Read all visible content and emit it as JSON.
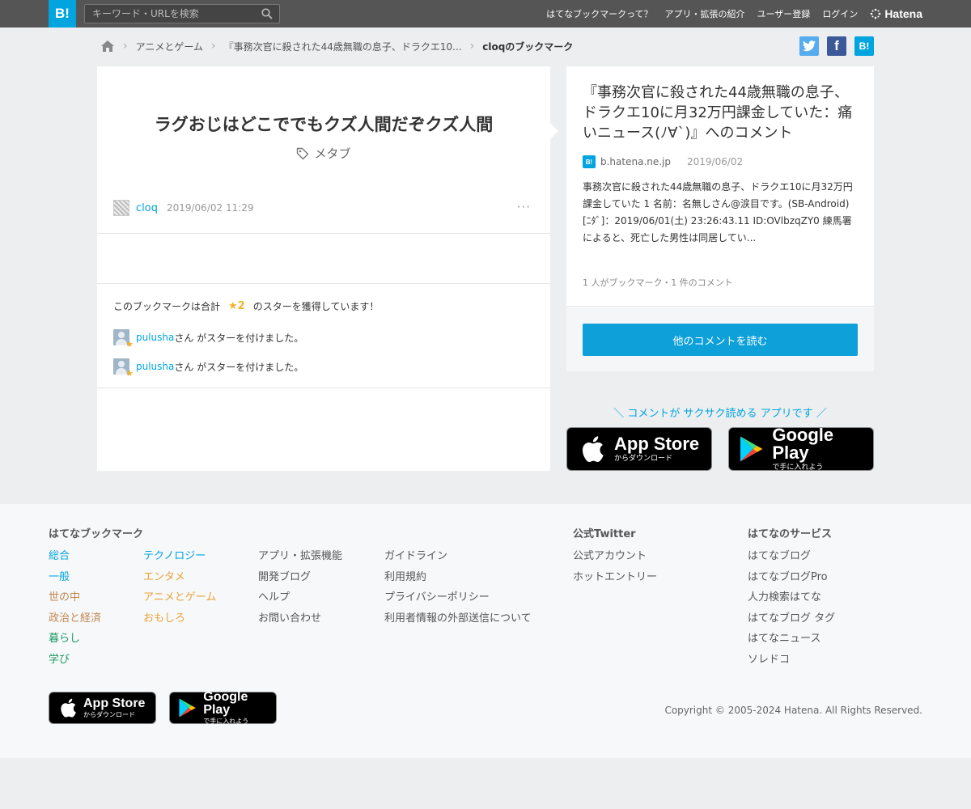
{
  "header": {
    "logo": "B!",
    "search_placeholder": "キーワード・URLを検索",
    "nav": [
      "はてなブックマークって？",
      "アプリ・拡張の紹介",
      "ユーザー登録",
      "ログイン"
    ],
    "brand": "Hatena"
  },
  "breadcrumb": {
    "items": [
      "アニメとゲーム",
      "『事務次官に殺された44歳無職の息子、ドラクエ10...",
      "cloqのブックマーク"
    ]
  },
  "share": {
    "twitter": "t",
    "facebook": "f",
    "hatena": "B!"
  },
  "bookmark": {
    "comment": "ラグおじはどこででもクズ人間だぞクズ人間",
    "tag": "メタブ",
    "user": "cloq",
    "datetime": "2019/06/02 11:29",
    "more": "···"
  },
  "stars": {
    "summary_prefix": "このブックマークは合計",
    "count": "★2",
    "summary_suffix": "のスターを獲得しています！",
    "entries": [
      {
        "user": "pulusha",
        "text": "さん がスターを付けました。"
      },
      {
        "user": "pulusha",
        "text": "さん がスターを付けました。"
      }
    ]
  },
  "entry": {
    "title": "『事務次官に殺された44歳無職の息子、ドラクエ10に月32万円課金していた：痛いニュース(ﾉ∀`)』へのコメント",
    "favicon": "B!",
    "source": "b.hatena.ne.jp",
    "date": "2019/06/02",
    "excerpt": "事務次官に殺された44歳無職の息子、ドラクエ10に月32万円課金していた 1 名前：名無しさん@涙目です。(SB-Android) [ﾆﾀﾞ]：2019/06/01(土) 23:26:43.11 ID:OVlbzqZY0 練馬署によると、死亡した男性は同居してい...",
    "counts": "1 人がブックマーク・1 件のコメント",
    "read_button": "他のコメントを読む"
  },
  "promo": {
    "text": "＼ コメントが サクサク読める アプリです ／",
    "appstore_big": "App Store",
    "appstore_small": "からダウンロード",
    "googleplay_big": "Google Play",
    "googleplay_small": "で手に入れよう"
  },
  "footer": {
    "heading1": "はてなブックマーク",
    "col1": [
      {
        "label": "総合",
        "color": "#00a4de"
      },
      {
        "label": "一般",
        "color": "#00a4de"
      },
      {
        "label": "世の中",
        "color": "#c0864f"
      },
      {
        "label": "政治と経済",
        "color": "#c0864f"
      },
      {
        "label": "暮らし",
        "color": "#1b9a65"
      },
      {
        "label": "学び",
        "color": "#1b9a65"
      }
    ],
    "col2": [
      {
        "label": "テクノロジー",
        "color": "#00a4de"
      },
      {
        "label": "エンタメ",
        "color": "#e8a33a"
      },
      {
        "label": "アニメとゲーム",
        "color": "#e8a33a"
      },
      {
        "label": "おもしろ",
        "color": "#e8a33a"
      }
    ],
    "col3": [
      "アプリ・拡張機能",
      "開発ブログ",
      "ヘルプ",
      "お問い合わせ"
    ],
    "col4": [
      "ガイドライン",
      "利用規約",
      "プライバシーポリシー",
      "利用者情報の外部送信について"
    ],
    "heading2": "公式Twitter",
    "col5": [
      "公式アカウント",
      "ホットエントリー"
    ],
    "heading3": "はてなのサービス",
    "col6": [
      "はてなブログ",
      "はてなブログPro",
      "人力検索はてな",
      "はてなブログ タグ",
      "はてなニュース",
      "ソレドコ"
    ],
    "copyright": "Copyright © 2005-2024 Hatena. All Rights Reserved."
  },
  "colors": {
    "accent": "#00a4de",
    "star": "#f4b128",
    "topbar": "#555555"
  }
}
